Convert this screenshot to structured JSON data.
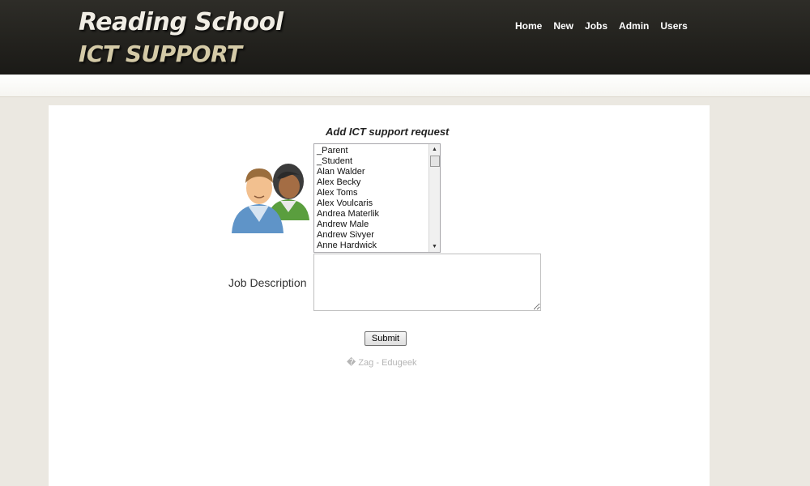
{
  "header": {
    "logo_line1": "Reading School",
    "logo_line2": "ICT SUPPORT",
    "nav": [
      "Home",
      "New",
      "Jobs",
      "Admin",
      "Users"
    ]
  },
  "form": {
    "title": "Add ICT support request",
    "users_icon": "users-icon",
    "user_options": [
      "_Parent",
      "_Student",
      "Alan Walder",
      "Alex Becky",
      "Alex Toms",
      "Alex Voulcaris",
      "Andrea Materlik",
      "Andrew Male",
      "Andrew Sivyer",
      "Anne Hardwick"
    ],
    "job_description_label": "Job Description",
    "job_description_value": "",
    "submit_label": "Submit"
  },
  "footer": {
    "credit": "� Zag - Edugeek"
  },
  "colors": {
    "header_bg": "#22211d",
    "page_bg": "#ebe8e1",
    "panel_bg": "#ffffff",
    "logo_accent": "#d4caa7"
  }
}
